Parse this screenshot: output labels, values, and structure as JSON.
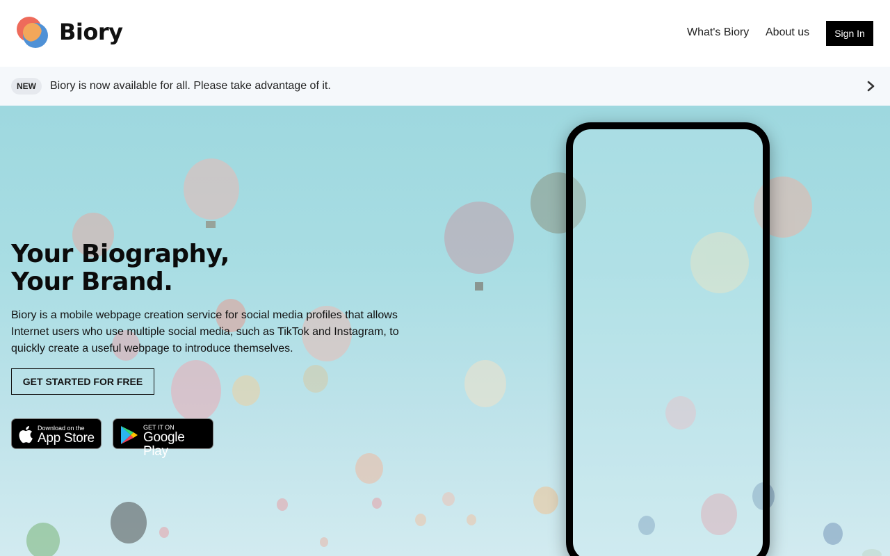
{
  "header": {
    "brand": "Biory",
    "nav": [
      "What's Biory",
      "About us"
    ],
    "signin_label": "Sign In"
  },
  "announcement": {
    "badge": "NEW",
    "text": "Biory is now available for all. Please take advantage of it.",
    "icon": "chevron-right-icon"
  },
  "hero": {
    "title_line1": "Your Biography,",
    "title_line2": "Your Brand.",
    "description": "Biory is a mobile webpage creation service for social media profiles that allows Internet users who use multiple social media, such as TikTok and Instagram, to quickly create a useful webpage to introduce themselves.",
    "cta_label": "GET STARTED FOR FREE",
    "appstore": {
      "small": "Download on the",
      "big": "App Store"
    },
    "googleplay": {
      "small": "GET IT ON",
      "big": "Google Play"
    }
  },
  "colors": {
    "accent_red": "#ee6b5b",
    "accent_orange": "#f3a75a",
    "accent_blue": "#4f91d6",
    "sky": "#9ed8df"
  }
}
